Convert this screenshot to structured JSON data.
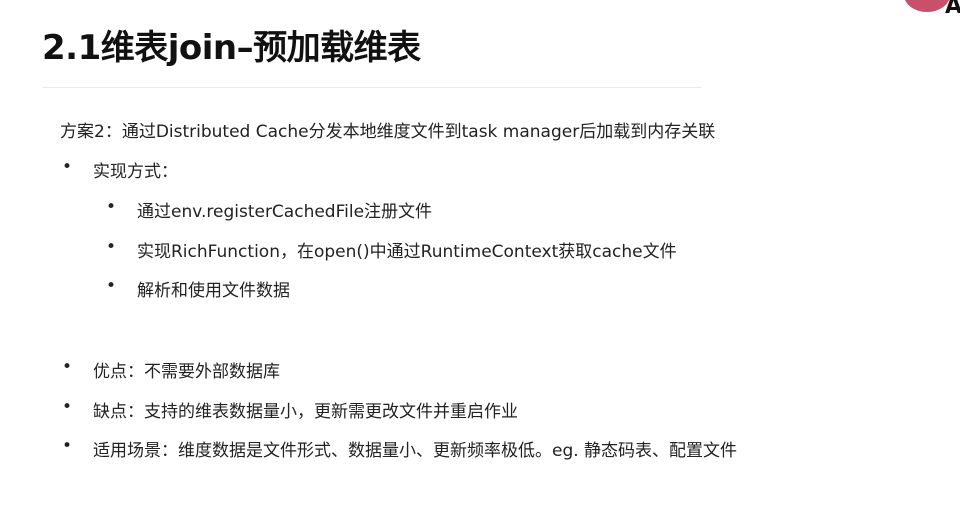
{
  "slide": {
    "title": "2.1维表join–预加载维表",
    "avatar_letter": "A"
  },
  "content": {
    "scheme": "方案2：通过Distributed Cache分发本地维度文件到task manager后加载到内存关联",
    "bullet_glyph": "•",
    "implementation": {
      "label": "实现方式：",
      "steps": [
        "通过env.registerCachedFile注册文件",
        "实现RichFunction，在open()中通过RuntimeContext获取cache文件",
        "解析和使用文件数据"
      ]
    },
    "points": [
      "优点：不需要外部数据库",
      "缺点：支持的维表数据量小，更新需更改文件并重启作业",
      "适用场景：维度数据是文件形式、数据量小、更新频率极低。eg. 静态码表、配置文件"
    ]
  }
}
